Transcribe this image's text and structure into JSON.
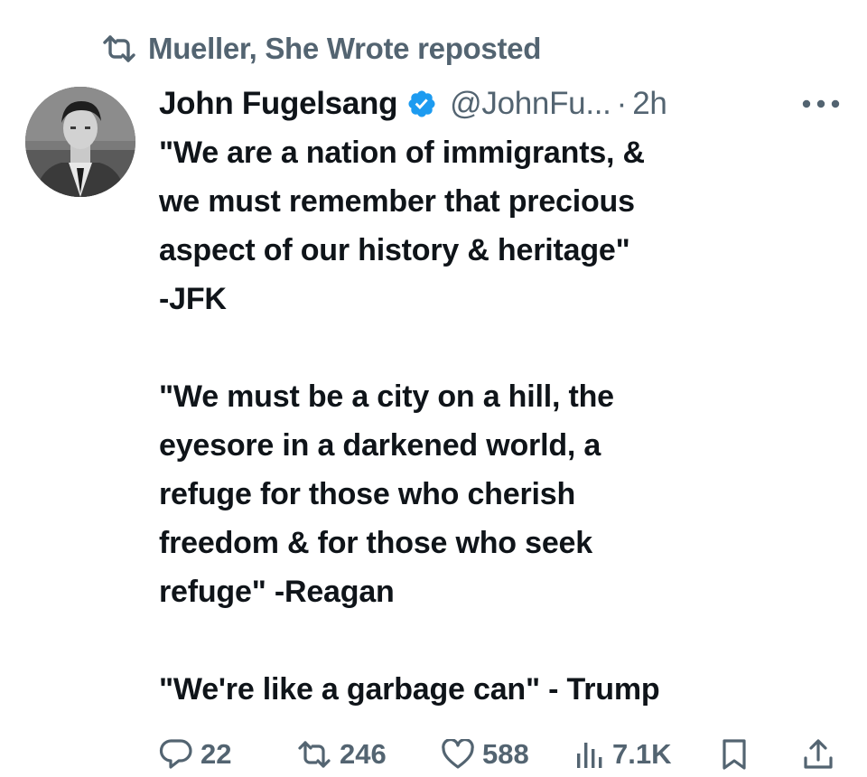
{
  "repost": {
    "icon": "repost-icon",
    "text": "Mueller, She Wrote reposted"
  },
  "tweet": {
    "author": {
      "name": "John Fugelsang",
      "handle": "@JohnFu...",
      "verified_icon": "verified-badge-icon",
      "avatar": "author-avatar"
    },
    "separator": "·",
    "time": "2h",
    "more_icon": "more-icon",
    "paragraphs": [
      "\"We are a nation of immigrants, &\nwe must remember that precious\naspect of our history & heritage\"\n-JFK",
      "\"We must be a city on a hill, the\neyesore in a darkened world, a\nrefuge for those who cherish\nfreedom & for those who seek\nrefuge\" -Reagan",
      "\"We're like a garbage can\" - Trump"
    ]
  },
  "actions": {
    "replies": {
      "icon": "reply-icon",
      "count": "22"
    },
    "reposts": {
      "icon": "repost-icon",
      "count": "246"
    },
    "likes": {
      "icon": "like-icon",
      "count": "588"
    },
    "views": {
      "icon": "views-icon",
      "count": "7.1K"
    },
    "bookmark": {
      "icon": "bookmark-icon"
    },
    "share": {
      "icon": "share-icon"
    }
  },
  "colors": {
    "text": "#0f1419",
    "secondary": "#536471",
    "verified": "#1d9bf0",
    "background": "#ffffff"
  }
}
